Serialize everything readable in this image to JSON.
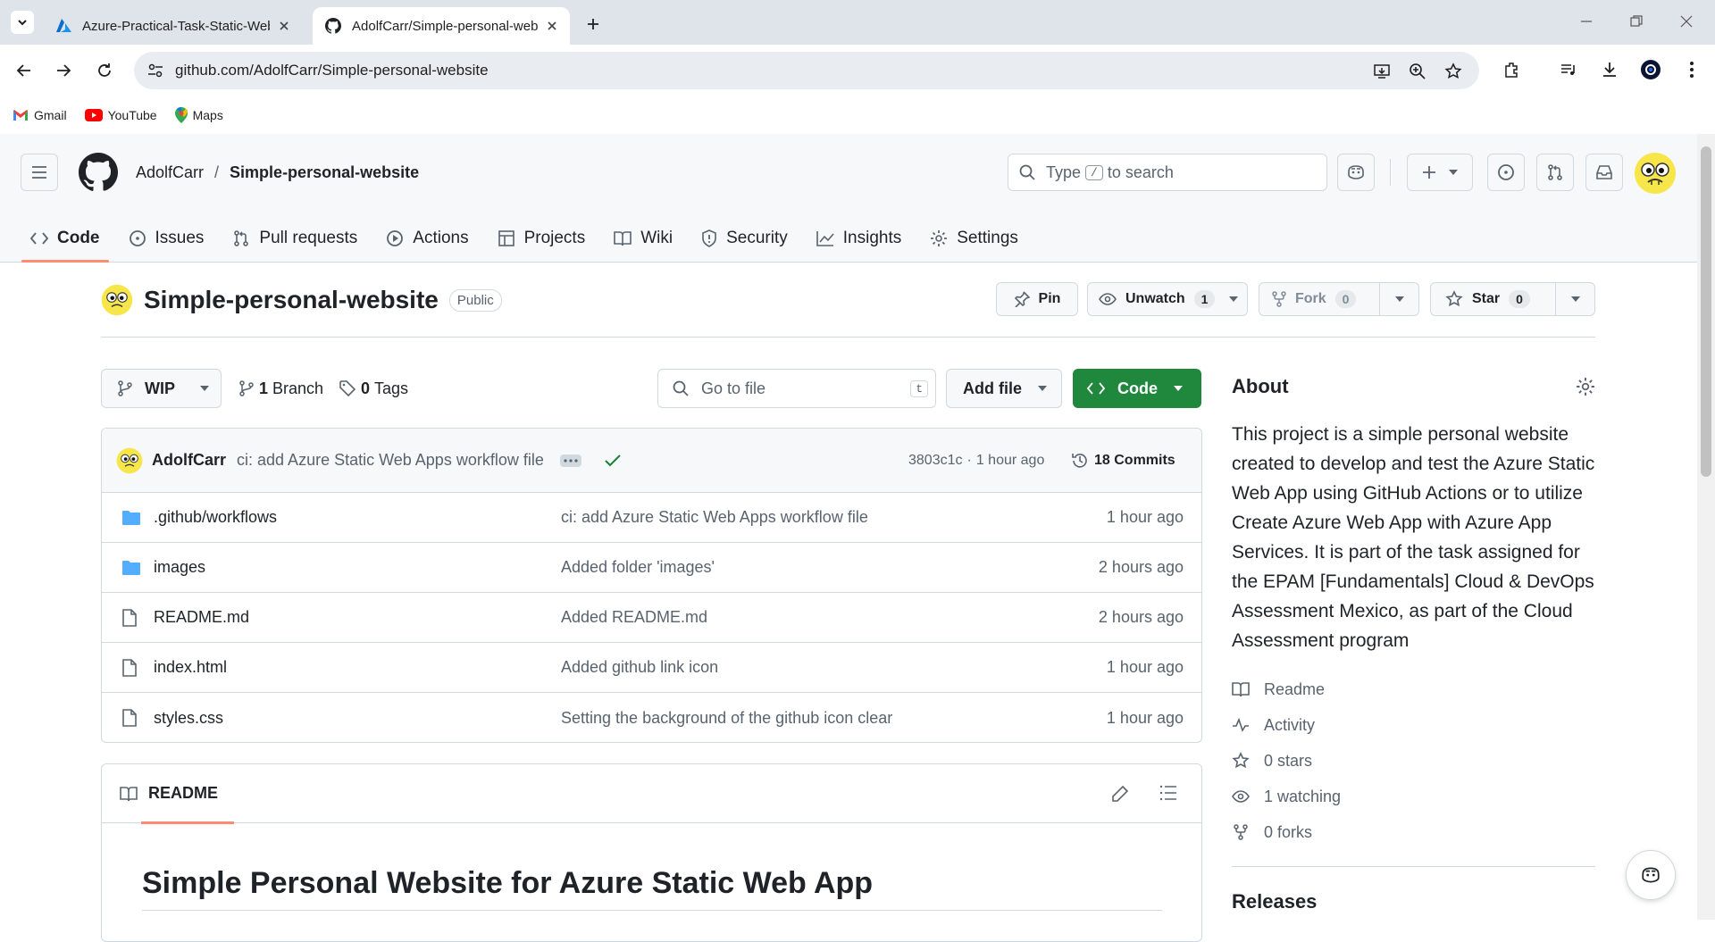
{
  "browser": {
    "tabs": [
      {
        "title": "Azure-Practical-Task-Static-Web"
      },
      {
        "title": "AdolfCarr/Simple-personal-web"
      }
    ],
    "url": "github.com/AdolfCarr/Simple-personal-website",
    "bookmarks": [
      "Gmail",
      "YouTube",
      "Maps"
    ]
  },
  "header": {
    "owner": "AdolfCarr",
    "separator": "/",
    "repo": "Simple-personal-website",
    "search_prefix": "Type",
    "search_key": "/",
    "search_suffix": "to search"
  },
  "nav": [
    "Code",
    "Issues",
    "Pull requests",
    "Actions",
    "Projects",
    "Wiki",
    "Security",
    "Insights",
    "Settings"
  ],
  "repo": {
    "name": "Simple-personal-website",
    "visibility": "Public",
    "pin": "Pin",
    "unwatch": "Unwatch",
    "watch_count": "1",
    "fork": "Fork",
    "fork_count": "0",
    "star": "Star",
    "star_count": "0"
  },
  "toolbar": {
    "branch": "WIP",
    "branches_num": "1",
    "branches_label": "Branch",
    "tags_num": "0",
    "tags_label": "Tags",
    "goto_placeholder": "Go to file",
    "goto_key": "t",
    "add_file": "Add file",
    "code": "Code"
  },
  "commit": {
    "author": "AdolfCarr",
    "message": "ci: add Azure Static Web Apps workflow file",
    "sha": "3803c1c",
    "dot": "·",
    "time": "1 hour ago",
    "commits": "18 Commits"
  },
  "files": [
    {
      "name": ".github/workflows",
      "type": "folder",
      "message": "ci: add Azure Static Web Apps workflow file",
      "age": "1 hour ago"
    },
    {
      "name": "images",
      "type": "folder",
      "message": "Added folder 'images'",
      "age": "2 hours ago"
    },
    {
      "name": "README.md",
      "type": "file",
      "message": "Added README.md",
      "age": "2 hours ago"
    },
    {
      "name": "index.html",
      "type": "file",
      "message": "Added github link icon",
      "age": "1 hour ago"
    },
    {
      "name": "styles.css",
      "type": "file",
      "message": "Setting the background of the github icon clear",
      "age": "1 hour ago"
    }
  ],
  "readme": {
    "tab": "README",
    "heading": "Simple Personal Website for Azure Static Web App"
  },
  "about": {
    "title": "About",
    "description": "This project is a simple personal website created to develop and test the Azure Static Web App using GitHub Actions or to utilize Create Azure Web App with Azure App Services. It is part of the task assigned for the EPAM [Fundamentals] Cloud & DevOps Assessment Mexico, as part of the Cloud Assessment program",
    "items": [
      "Readme",
      "Activity",
      "0 stars",
      "1 watching",
      "0 forks"
    ],
    "releases": "Releases"
  },
  "colors": {
    "accent_green": "#1f883d",
    "nav_underline": "#fd8c73",
    "folder_blue": "#54aeff",
    "check_green": "#1a7f37"
  }
}
